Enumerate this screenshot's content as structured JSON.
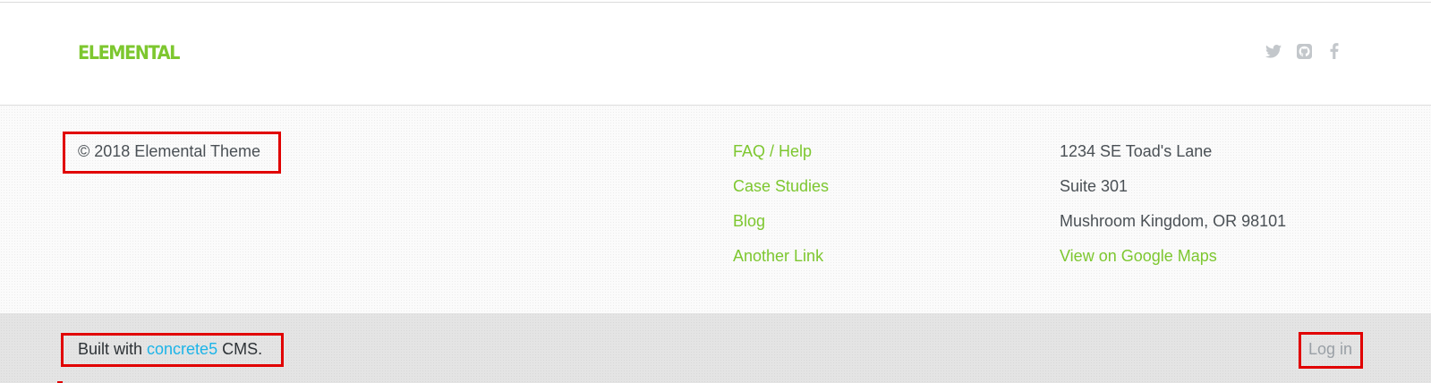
{
  "brand": {
    "logo_text": "ELEMENTAL",
    "accent_color": "#7dc72f"
  },
  "header": {
    "social_icons": [
      "twitter-icon",
      "github-icon",
      "facebook-icon"
    ]
  },
  "footer": {
    "copyright": "© 2018 Elemental Theme",
    "links": [
      "FAQ / Help",
      "Case Studies",
      "Blog",
      "Another Link"
    ],
    "address": {
      "line1": "1234 SE Toad's Lane",
      "line2": "Suite 301",
      "line3": "Mushroom Kingdom, OR 98101",
      "map_link": "View on Google Maps"
    }
  },
  "bottom_bar": {
    "built_prefix": "Built with ",
    "cms_link": "concrete5",
    "built_suffix": " CMS.",
    "login_label": "Log in",
    "link_color": "#1cb4e8"
  }
}
